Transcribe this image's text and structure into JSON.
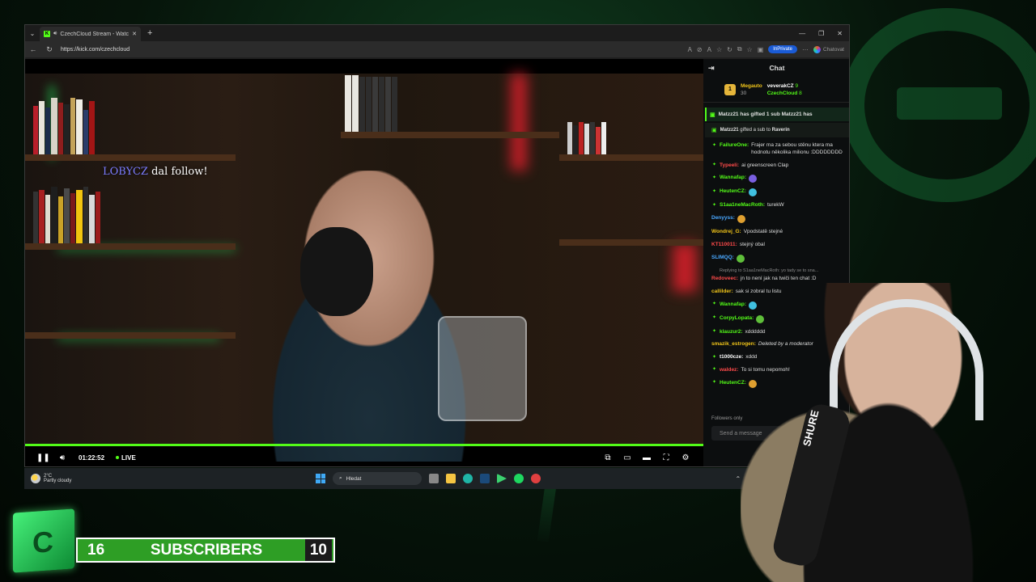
{
  "browser": {
    "tab_title": "CzechCloud Stream - Watch Live",
    "url": "https://kick.com/czechcloud",
    "inprivate_label": "InPrivate",
    "chatovat_label": "Chatovat"
  },
  "video": {
    "follow_overlay": {
      "nick": "LOBYCZ",
      "text": " dal follow!"
    },
    "time": "01:22:52",
    "live_label": "LIVE",
    "progress": 1.0
  },
  "chat": {
    "title": "Chat",
    "leaderboard": [
      {
        "rank": "1",
        "name": "Megauto",
        "value": "30"
      },
      {
        "name": "veverakCZ",
        "value": "9"
      },
      {
        "name": "CzechCloud",
        "value": "8"
      }
    ],
    "gift_banner": "Matzz21 has gifted 1 sub   Matzz21 has",
    "gift_message": {
      "user": "Matzz21",
      "mid": " gifted a sub to ",
      "target": "Raverin"
    },
    "messages": [
      {
        "user": "FailureOne:",
        "color": "#53fc18",
        "badge": "✦",
        "text": "Frajer ma za sebou stěnu ktera ma hodnotu několika milionu :DDDDDDDD"
      },
      {
        "user": "Typeeli:",
        "color": "#ff4a4a",
        "badge": "✦",
        "text": "ai greenscreen Clap"
      },
      {
        "user": "Wannafap:",
        "color": "#53fc18",
        "badge": "✦",
        "text": ""
      },
      {
        "user": "HeutenCZ:",
        "color": "#53fc18",
        "badge": "✦",
        "text": ""
      },
      {
        "user": "S1aa1neMacRoth:",
        "color": "#53fc18",
        "badge": "✦",
        "text": "turekW"
      },
      {
        "user": "Denyyss:",
        "color": "#4aa8ff",
        "badge": "",
        "text": ""
      },
      {
        "user": "Wondrej_G:",
        "color": "#f0c419",
        "badge": "",
        "text": "Vpodstatě stejné"
      },
      {
        "user": "KT110011:",
        "color": "#ff4a4a",
        "badge": "",
        "text": "stejný obal"
      },
      {
        "user": "SLIMQQ:",
        "color": "#4aa8ff",
        "badge": "",
        "text": ""
      },
      {
        "user": "Redoveec:",
        "color": "#ff4a4a",
        "badge": "",
        "text": "jn to není jak na twiči ten chat :D",
        "reply": "Replying to S1aa1neMacRoth: yo tady se to sna..."
      },
      {
        "user": "callilder:",
        "color": "#f0c419",
        "badge": "",
        "text": "sak si zobral tu listu"
      },
      {
        "user": "Wannafap:",
        "color": "#53fc18",
        "badge": "✦",
        "text": ""
      },
      {
        "user": "CorpyLopata:",
        "color": "#53fc18",
        "badge": "✦",
        "text": ""
      },
      {
        "user": "klauzur2:",
        "color": "#53fc18",
        "badge": "✦",
        "text": "xdddddd"
      },
      {
        "user": "smazik_estrogen:",
        "color": "#f0c419",
        "badge": "",
        "text": "Deleted by a moderator",
        "deleted": true
      },
      {
        "user": "t1000cze:",
        "color": "#fff",
        "badge": "✦",
        "text": "xddd"
      },
      {
        "user": "waldez:",
        "color": "#ff4a4a",
        "badge": "✦",
        "text": "To si tomu nepomoh!"
      },
      {
        "user": "HeutenCZ:",
        "color": "#53fc18",
        "badge": "✦",
        "text": ""
      }
    ],
    "followers_only": "Followers only",
    "input_placeholder": "Send a message"
  },
  "taskbar": {
    "temperature": "2°C",
    "weather": "Partly cloudy",
    "search_label": "Hledat"
  },
  "subs": {
    "count": "16",
    "label": "SUBSCRIBERS",
    "goal": "10"
  },
  "webcam": {
    "mic_text": "SHURE"
  }
}
